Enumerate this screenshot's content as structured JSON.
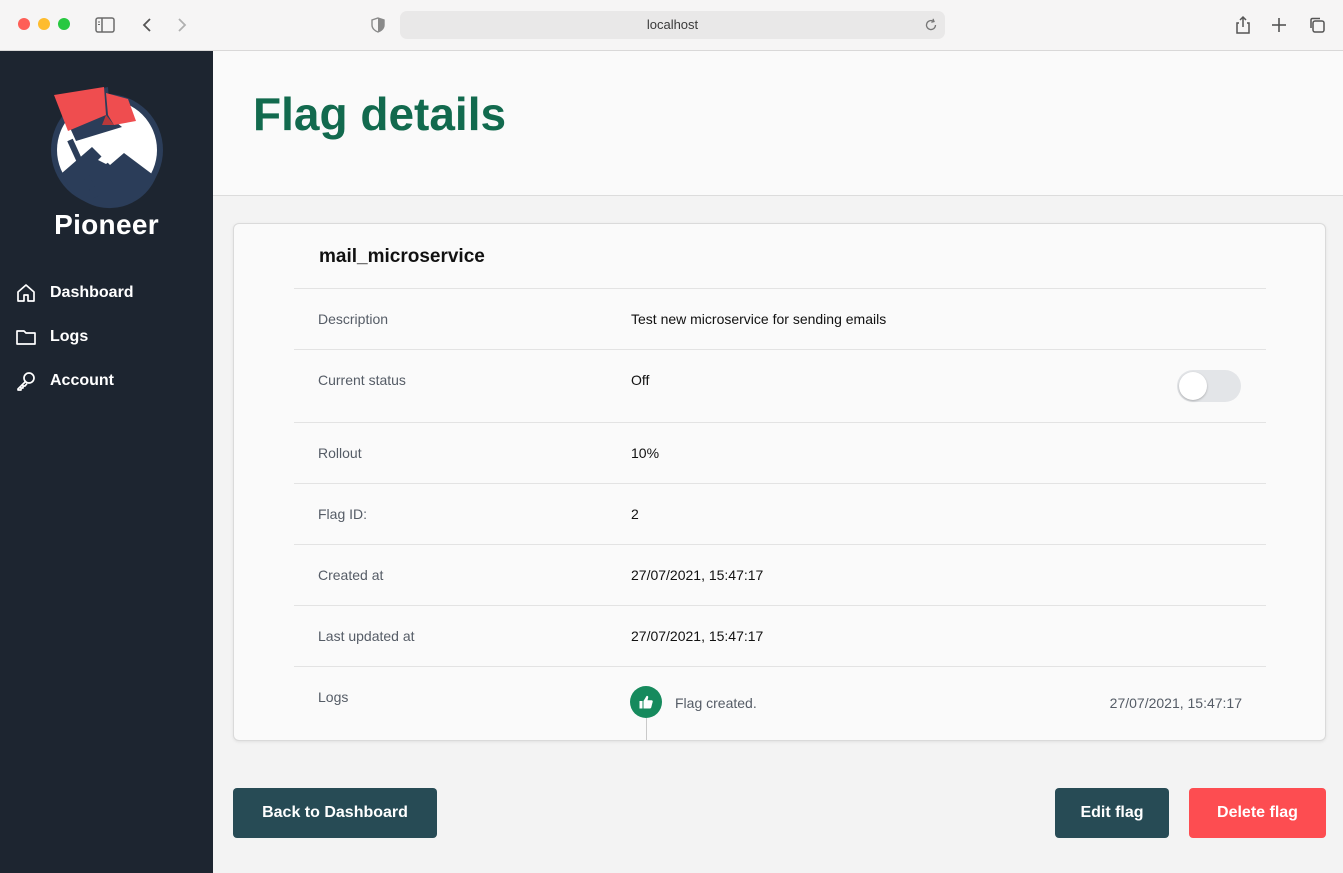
{
  "browser": {
    "url": "localhost"
  },
  "sidebar": {
    "brand": "Pioneer",
    "items": [
      {
        "label": "Dashboard",
        "icon": "home-icon"
      },
      {
        "label": "Logs",
        "icon": "folder-icon"
      },
      {
        "label": "Account",
        "icon": "key-icon"
      }
    ]
  },
  "header": {
    "title": "Flag details"
  },
  "flag": {
    "name": "mail_microservice",
    "rows": [
      {
        "label": "Description",
        "value": "Test new microservice for sending emails"
      },
      {
        "label": "Current status",
        "value": "Off"
      },
      {
        "label": "Rollout",
        "value": "10%"
      },
      {
        "label": "Flag ID:",
        "value": "2"
      },
      {
        "label": "Created at",
        "value": "27/07/2021, 15:47:17"
      },
      {
        "label": "Last updated at",
        "value": "27/07/2021, 15:47:17"
      },
      {
        "label": "Logs",
        "value": ""
      }
    ],
    "status_on": false,
    "logs": [
      {
        "text": "Flag created.",
        "time": "27/07/2021, 15:47:17",
        "icon": "thumbs-up-icon"
      }
    ]
  },
  "actions": {
    "back": "Back to Dashboard",
    "edit": "Edit flag",
    "delete": "Delete flag"
  },
  "colors": {
    "sidebar_bg": "#1d2530",
    "title_green": "#126a4e",
    "button_dark": "#274b55",
    "button_delete": "#fd4d51",
    "log_badge": "#168a5d"
  }
}
